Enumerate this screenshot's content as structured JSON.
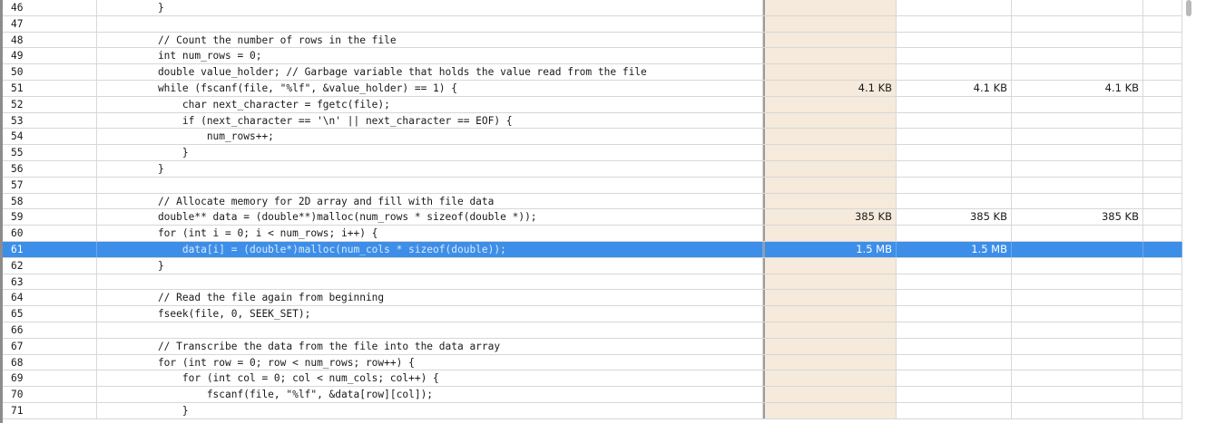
{
  "rows": [
    {
      "ln": "46",
      "code": "    }",
      "m1": "",
      "m2": "",
      "m3": ""
    },
    {
      "ln": "47",
      "code": "",
      "m1": "",
      "m2": "",
      "m3": ""
    },
    {
      "ln": "48",
      "code": "    // Count the number of rows in the file",
      "m1": "",
      "m2": "",
      "m3": ""
    },
    {
      "ln": "49",
      "code": "    int num_rows = 0;",
      "m1": "",
      "m2": "",
      "m3": ""
    },
    {
      "ln": "50",
      "code": "    double value_holder; // Garbage variable that holds the value read from the file",
      "m1": "",
      "m2": "",
      "m3": ""
    },
    {
      "ln": "51",
      "code": "    while (fscanf(file, \"%lf\", &value_holder) == 1) {",
      "m1": "4.1 KB",
      "m2": "4.1 KB",
      "m3": "4.1 KB"
    },
    {
      "ln": "52",
      "code": "        char next_character = fgetc(file);",
      "m1": "",
      "m2": "",
      "m3": ""
    },
    {
      "ln": "53",
      "code": "        if (next_character == '\\n' || next_character == EOF) {",
      "m1": "",
      "m2": "",
      "m3": ""
    },
    {
      "ln": "54",
      "code": "            num_rows++;",
      "m1": "",
      "m2": "",
      "m3": ""
    },
    {
      "ln": "55",
      "code": "        }",
      "m1": "",
      "m2": "",
      "m3": ""
    },
    {
      "ln": "56",
      "code": "    }",
      "m1": "",
      "m2": "",
      "m3": ""
    },
    {
      "ln": "57",
      "code": "",
      "m1": "",
      "m2": "",
      "m3": ""
    },
    {
      "ln": "58",
      "code": "    // Allocate memory for 2D array and fill with file data",
      "m1": "",
      "m2": "",
      "m3": ""
    },
    {
      "ln": "59",
      "code": "    double** data = (double**)malloc(num_rows * sizeof(double *));",
      "m1": "385 KB",
      "m2": "385 KB",
      "m3": "385 KB"
    },
    {
      "ln": "60",
      "code": "    for (int i = 0; i < num_rows; i++) {",
      "m1": "",
      "m2": "",
      "m3": ""
    },
    {
      "ln": "61",
      "code": "        data[i] = (double*)malloc(num_cols * sizeof(double));",
      "m1": "1.5 MB",
      "m2": "1.5 MB",
      "m3": ""
    },
    {
      "ln": "62",
      "code": "    }",
      "m1": "",
      "m2": "",
      "m3": ""
    },
    {
      "ln": "63",
      "code": "",
      "m1": "",
      "m2": "",
      "m3": ""
    },
    {
      "ln": "64",
      "code": "    // Read the file again from beginning",
      "m1": "",
      "m2": "",
      "m3": ""
    },
    {
      "ln": "65",
      "code": "    fseek(file, 0, SEEK_SET);",
      "m1": "",
      "m2": "",
      "m3": ""
    },
    {
      "ln": "66",
      "code": "",
      "m1": "",
      "m2": "",
      "m3": ""
    },
    {
      "ln": "67",
      "code": "    // Transcribe the data from the file into the data array",
      "m1": "",
      "m2": "",
      "m3": ""
    },
    {
      "ln": "68",
      "code": "    for (int row = 0; row < num_rows; row++) {",
      "m1": "",
      "m2": "",
      "m3": ""
    },
    {
      "ln": "69",
      "code": "        for (int col = 0; col < num_cols; col++) {",
      "m1": "",
      "m2": "",
      "m3": ""
    },
    {
      "ln": "70",
      "code": "            fscanf(file, \"%lf\", &data[row][col]);",
      "m1": "",
      "m2": "",
      "m3": ""
    },
    {
      "ln": "71",
      "code": "        }",
      "m1": "",
      "m2": "",
      "m3": ""
    }
  ],
  "selected_line": "61",
  "colors": {
    "selection": "#3d8ee8",
    "metric_column_bg": "#f5eadb",
    "grid": "#d7d7d7"
  }
}
